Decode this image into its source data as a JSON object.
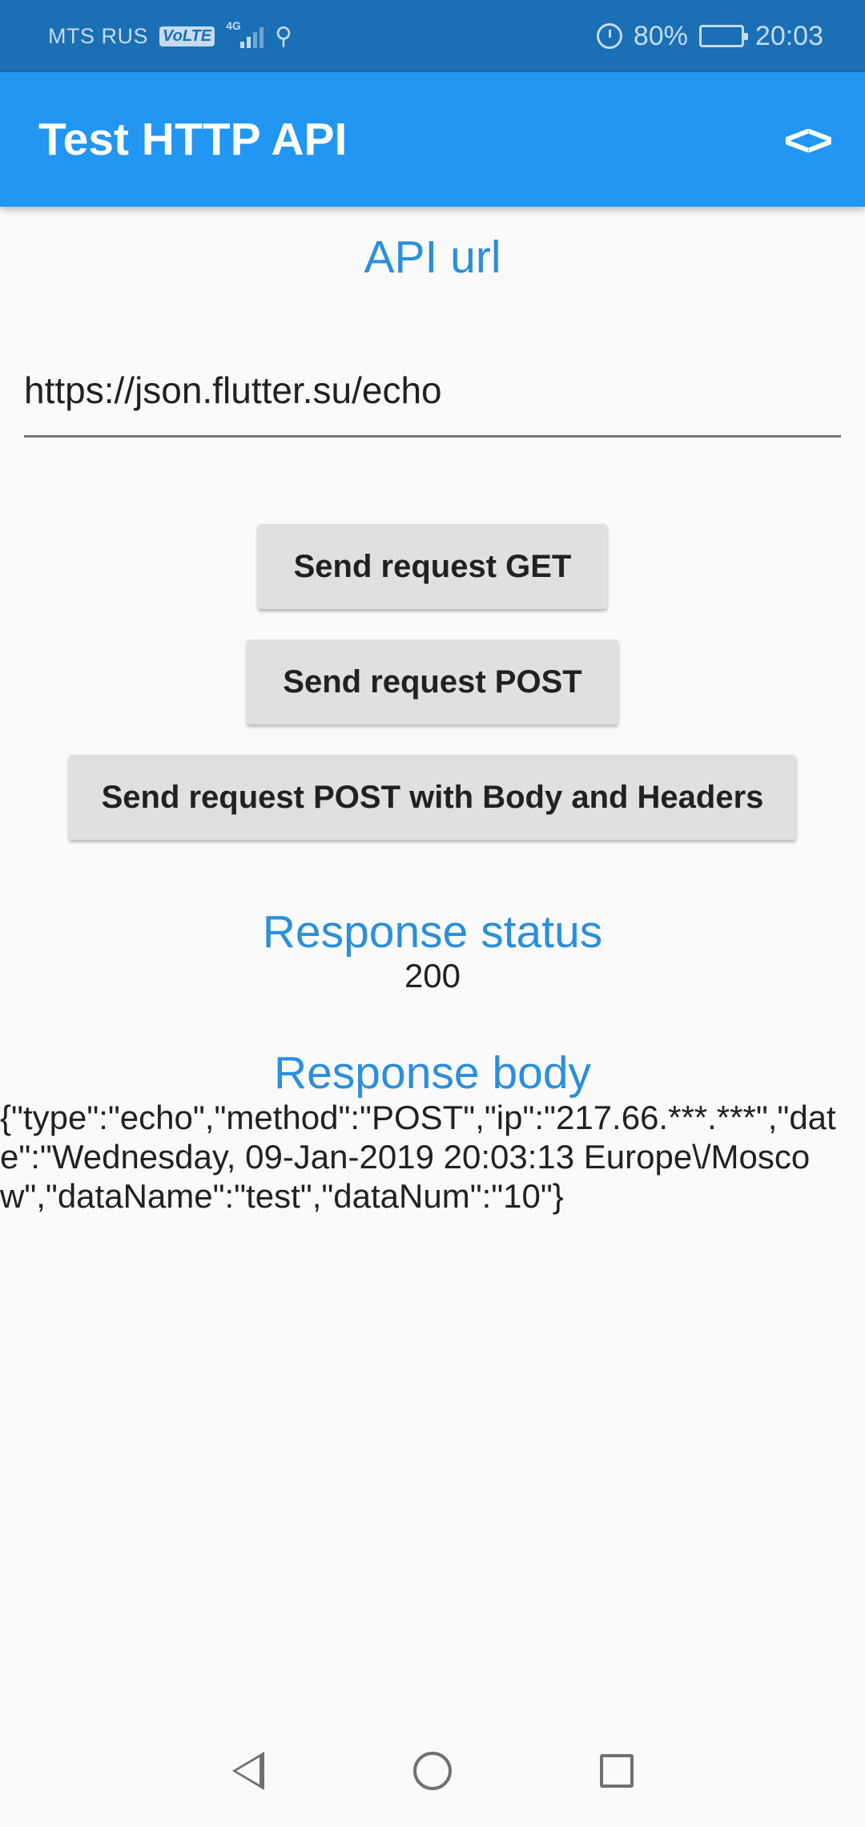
{
  "status_bar": {
    "carrier": "MTS RUS",
    "volte": "VoLTE",
    "network": "4G",
    "battery": "80%",
    "time": "20:03",
    "icons": [
      "volte-icon",
      "signal-icon",
      "usb-icon",
      "alarm-icon",
      "battery-icon"
    ]
  },
  "app_bar": {
    "title": "Test HTTP API",
    "action_icon": "code-icon",
    "action_glyph": "<>"
  },
  "api_url": {
    "title": "API url",
    "value": "https://json.flutter.su/echo"
  },
  "buttons": {
    "get": "Send request GET",
    "post": "Send request POST",
    "post_body_headers": "Send request POST with Body and Headers"
  },
  "response_status": {
    "title": "Response status",
    "value": "200"
  },
  "response_body": {
    "title": "Response body",
    "value": "{\"type\":\"echo\",\"method\":\"POST\",\"ip\":\"217.66.***.***\",\"date\":\"Wednesday, 09-Jan-2019 20:03:13 Europe\\/Moscow\",\"dataName\":\"test\",\"dataNum\":\"10\"}"
  },
  "nav_bar": {
    "icons": [
      "back-icon",
      "home-icon",
      "recents-icon"
    ]
  },
  "colors": {
    "status_bar": "#1a6fb5",
    "app_bar": "#2196f3",
    "accent_text": "#2b8fdc",
    "button_bg": "#e0e0e0",
    "background": "#fafafa"
  }
}
